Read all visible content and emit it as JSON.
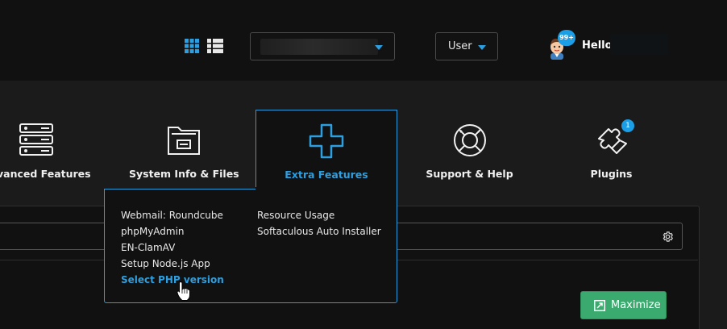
{
  "header": {
    "view_toggle": {
      "grid_icon": "grid-view-icon",
      "list_icon": "list-view-icon",
      "active": "grid"
    },
    "user_select": {
      "label": "User"
    },
    "notifications": {
      "count": "99+"
    },
    "greeting": "Hello,"
  },
  "nav": {
    "items": [
      {
        "label": "Advanced Features",
        "icon": "server-stack-icon"
      },
      {
        "label": "System Info & Files",
        "icon": "folder-icon"
      },
      {
        "label": "Extra Features",
        "icon": "plus-icon",
        "active": true
      },
      {
        "label": "Support & Help",
        "icon": "lifebuoy-icon"
      },
      {
        "label": "Plugins",
        "icon": "puzzle-icon",
        "badge": "1"
      }
    ]
  },
  "dropdown": {
    "column1": [
      "Webmail: Roundcube",
      "phpMyAdmin",
      "EN-ClamAV",
      "Setup Node.js App",
      "Select PHP version"
    ],
    "column2": [
      "Resource Usage",
      "Softaculous Auto Installer"
    ],
    "hovered": "Select PHP version"
  },
  "content": {
    "maximize_label": "Maximize"
  },
  "colors": {
    "accent": "#2d9fe0",
    "success": "#3aaa6e",
    "background": "#1b1b1b",
    "panel": "#111111"
  }
}
